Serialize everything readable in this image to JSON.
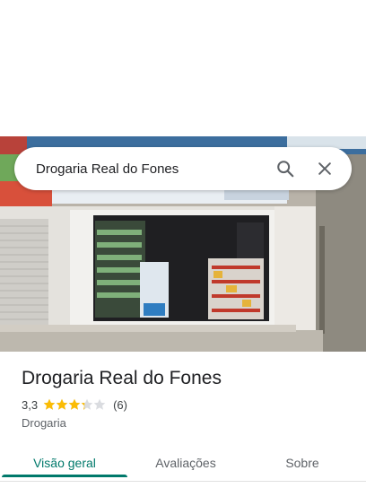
{
  "search": {
    "query": "Drogaria Real do Fones",
    "search_icon": "search-icon",
    "close_icon": "close-icon"
  },
  "place": {
    "title": "Drogaria Real do Fones",
    "rating": "3,3",
    "rating_value": 3.3,
    "rating_max": 5,
    "review_count": "(6)",
    "category": "Drogaria"
  },
  "tabs": [
    {
      "label": "Visão geral",
      "active": true
    },
    {
      "label": "Avaliações",
      "active": false
    },
    {
      "label": "Sobre",
      "active": false
    }
  ],
  "colors": {
    "accent": "#00796b",
    "star": "#fbbc04",
    "star_empty": "#dadce0"
  }
}
